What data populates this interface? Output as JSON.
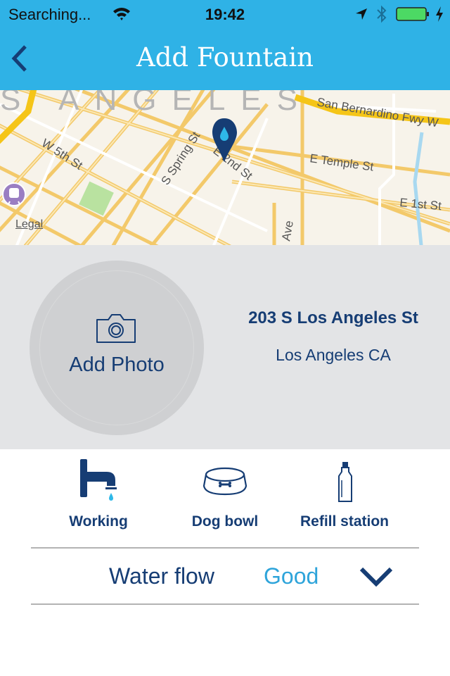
{
  "status_bar": {
    "carrier": "Searching...",
    "time": "19:42",
    "icons": [
      "wifi-icon",
      "location-arrow-icon",
      "bluetooth-icon",
      "battery-icon",
      "charging-icon"
    ],
    "battery_percent": 100,
    "battery_color": "#4cd964"
  },
  "nav": {
    "title": "Add Fountain",
    "back_icon": "chevron-left-icon",
    "bar_color": "#2fb2e6"
  },
  "map": {
    "area_label": "LOS ANGELES",
    "streets": [
      "W 5th St",
      "S Spring St",
      "E 2nd St",
      "San Bernardino Fwy W",
      "E Temple St",
      "E 1st St",
      "Ave"
    ],
    "legal_link": "Legal",
    "pin_icon": "water-drop-pin-icon",
    "transit_icon": "train-icon"
  },
  "photo": {
    "label": "Add Photo",
    "icon": "camera-icon"
  },
  "address": {
    "street": "203 S Los Angeles St",
    "city": "Los Angeles CA"
  },
  "features": [
    {
      "label": "Working",
      "icon": "faucet-icon"
    },
    {
      "label": "Dog bowl",
      "icon": "dog-bowl-icon"
    },
    {
      "label": "Refill station",
      "icon": "water-bottle-icon"
    }
  ],
  "water_flow": {
    "label": "Water flow",
    "value": "Good",
    "icon": "chevron-down-icon"
  },
  "colors": {
    "primary_dark": "#163d74",
    "accent": "#2ea4da"
  }
}
